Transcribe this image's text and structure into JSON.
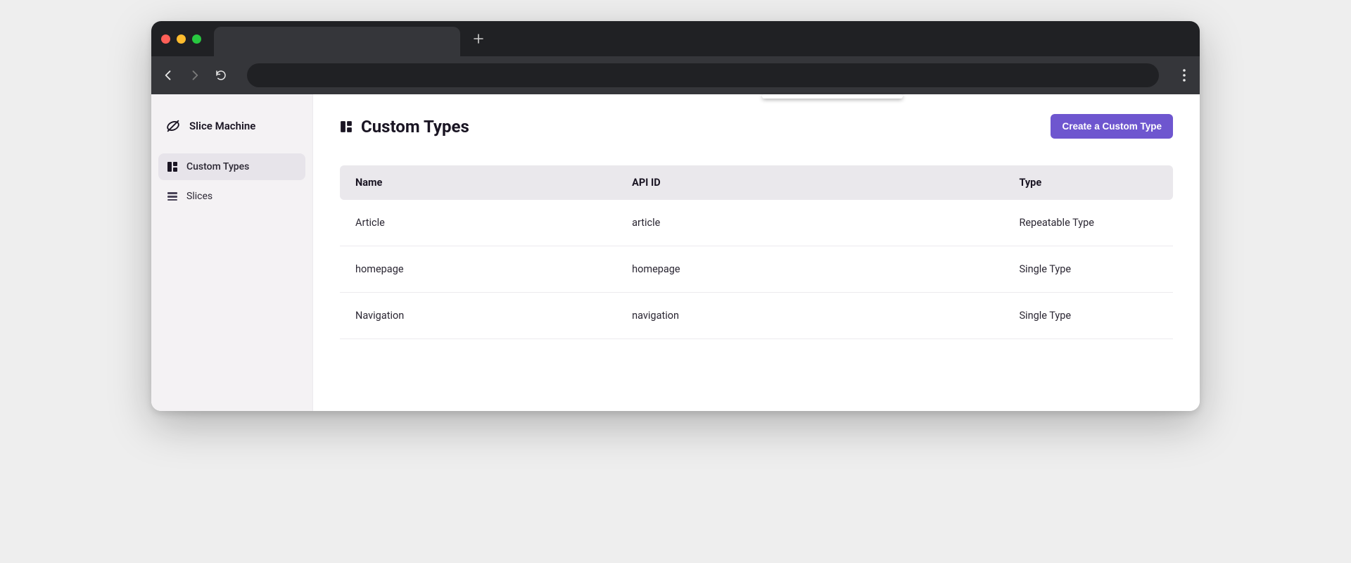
{
  "app": {
    "brand": "Slice Machine"
  },
  "sidebar": {
    "items": [
      {
        "label": "Custom Types",
        "active": true
      },
      {
        "label": "Slices",
        "active": false
      }
    ]
  },
  "page": {
    "title": "Custom Types",
    "primary_action": "Create a Custom Type"
  },
  "table": {
    "headers": {
      "name": "Name",
      "api_id": "API ID",
      "type": "Type"
    },
    "rows": [
      {
        "name": "Article",
        "api_id": "article",
        "type": "Repeatable Type"
      },
      {
        "name": "homepage",
        "api_id": "homepage",
        "type": "Single Type"
      },
      {
        "name": "Navigation",
        "api_id": "navigation",
        "type": "Single Type"
      }
    ]
  }
}
